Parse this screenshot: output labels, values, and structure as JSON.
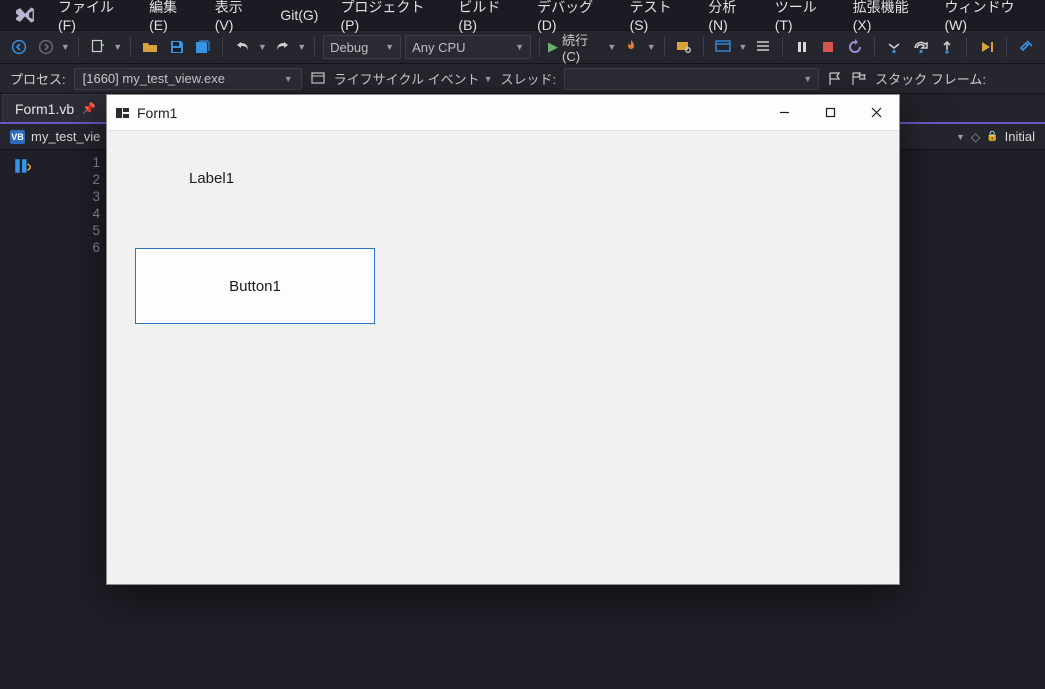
{
  "menubar": {
    "items": [
      {
        "label": "ファイル(F)"
      },
      {
        "label": "編集(E)"
      },
      {
        "label": "表示(V)"
      },
      {
        "label": "Git(G)"
      },
      {
        "label": "プロジェクト(P)"
      },
      {
        "label": "ビルド(B)"
      },
      {
        "label": "デバッグ(D)"
      },
      {
        "label": "テスト(S)"
      },
      {
        "label": "分析(N)"
      },
      {
        "label": "ツール(T)"
      },
      {
        "label": "拡張機能(X)"
      },
      {
        "label": "ウィンドウ(W)"
      }
    ]
  },
  "toolbar": {
    "config": "Debug",
    "platform": "Any CPU",
    "run_label": "続行(C)"
  },
  "toolbar2": {
    "process_label": "プロセス:",
    "process_value": "[1660] my_test_view.exe",
    "lifecycle_label": "ライフサイクル イベント",
    "thread_label": "スレッド:",
    "stackframe_label": "スタック フレーム:"
  },
  "doc": {
    "tab_label": "Form1.vb",
    "nav_project": "my_test_vie",
    "nav_member": "Initial"
  },
  "editor": {
    "line_numbers": [
      "1",
      "2",
      "3",
      "4",
      "5",
      "6"
    ]
  },
  "form": {
    "title": "Form1",
    "label_text": "Label1",
    "button_text": "Button1"
  }
}
